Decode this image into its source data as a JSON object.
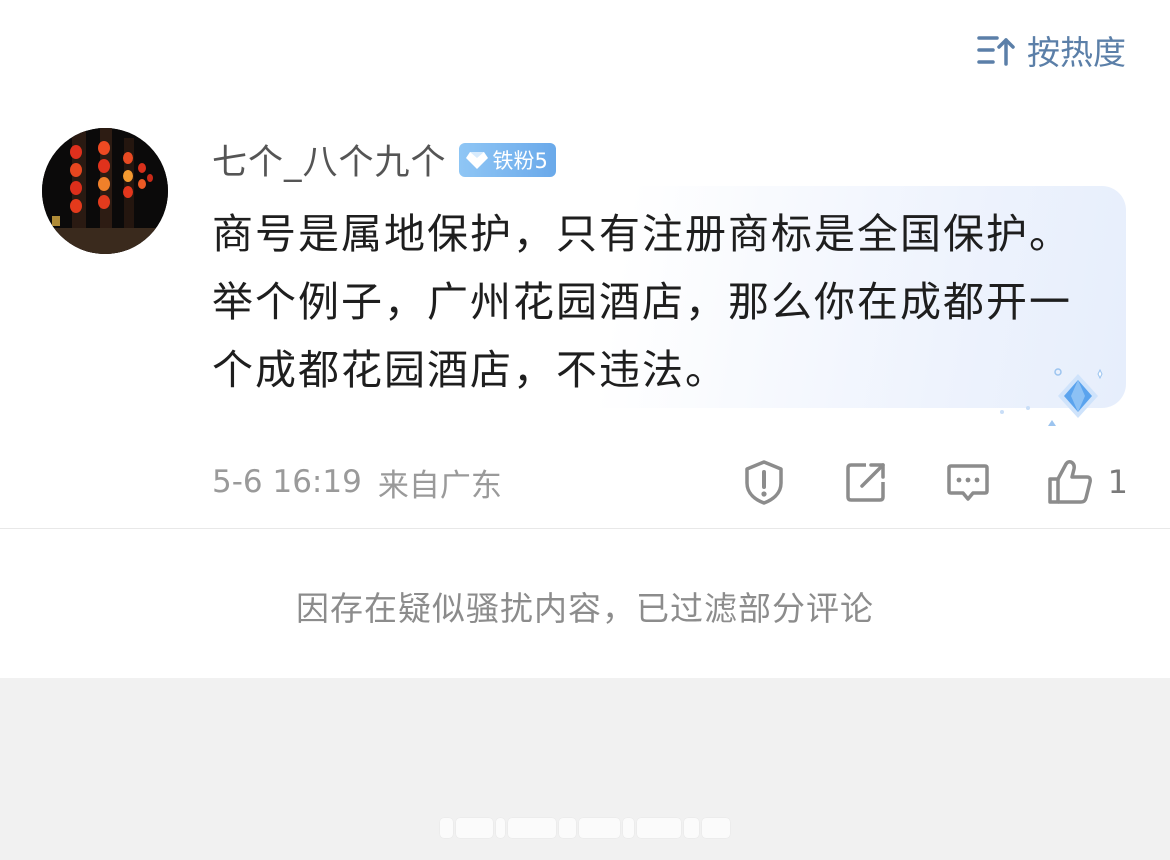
{
  "header": {
    "sort_label": "按热度",
    "sort_icon": "sort-by-heat-icon"
  },
  "comment": {
    "avatar_icon": "avatar-red-lanterns-night",
    "username": "七个_八个九个",
    "badge": {
      "icon": "diamond-icon",
      "label": "铁粉5",
      "color": "#7bb6ef"
    },
    "text": "商号是属地保护，只有注册商标是全国保护。举个例子，广州花园酒店，那么你在成都开一个成都花园酒店，不违法。",
    "date": "5-6 16:19",
    "location": "来自广东",
    "actions": {
      "report_icon": "report-shield-icon",
      "share_icon": "share-edit-icon",
      "reply_icon": "comment-bubble-icon",
      "like_icon": "thumbs-up-icon",
      "like_count": "1"
    }
  },
  "notice": "因存在疑似骚扰内容，已过滤部分评论",
  "colors": {
    "accent": "#5b7fa8",
    "meta_text": "#9a9a9a",
    "footer_bg": "#f1f1f1"
  }
}
